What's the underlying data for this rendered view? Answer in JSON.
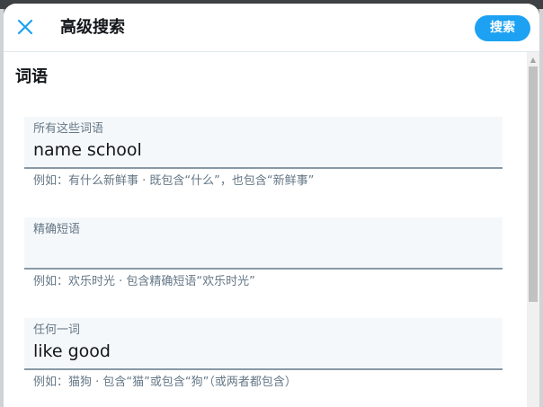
{
  "header": {
    "title": "高级搜索",
    "search_label": "搜索"
  },
  "words_section": {
    "title": "词语",
    "fields": [
      {
        "label": "所有这些词语",
        "value": "name school",
        "hint": "例如：有什么新鲜事 · 既包含“什么”，也包含“新鲜事”"
      },
      {
        "label": "精确短语",
        "value": "",
        "hint": "例如：欢乐时光 · 包含精确短语“欢乐时光”"
      },
      {
        "label": "任何一词",
        "value": "like good",
        "hint": "例如：猫狗 · 包含“猫”或包含“狗”（或两者都包含）"
      }
    ]
  },
  "colors": {
    "accent": "#1da1f2",
    "field_bg": "#f5f8fa",
    "field_border": "#8899a6",
    "muted_text": "#657786"
  },
  "icons": {
    "close": "close-icon",
    "scroll_up": "scroll-up-arrow-icon"
  }
}
